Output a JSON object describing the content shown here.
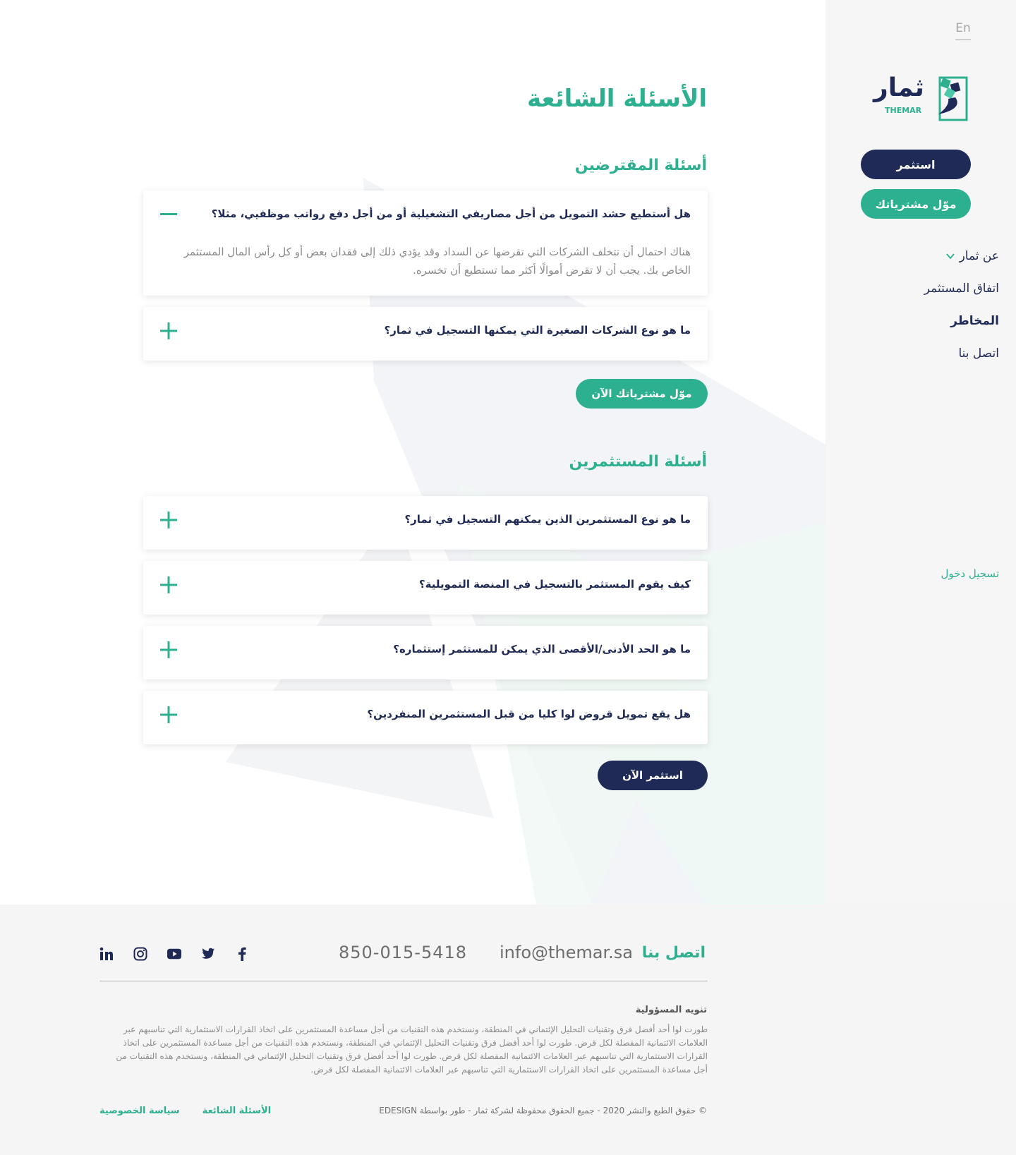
{
  "colors": {
    "navy": "#1f2a56",
    "green": "#2db08f",
    "sidebar_bg": "#f6f6f6",
    "footer_bg": "#f5f5f5"
  },
  "sidebar": {
    "lang_label": "En",
    "logo_text_ar": "ثمار",
    "logo_text_en": "THEMAR",
    "invest_button": "استثمر",
    "finance_button": "موّل مشترياتك",
    "nav": [
      {
        "label": "عن ثمار",
        "has_dropdown": true
      },
      {
        "label": "اتفاق المستثمر"
      },
      {
        "label": "المخاطر",
        "active": true
      },
      {
        "label": "اتصل بنا"
      }
    ],
    "login_link": "تسجيل دخول"
  },
  "main": {
    "title": "الأسئلة الشائعة",
    "borrowers": {
      "title": "أسئلة المقترضين",
      "items": [
        {
          "question": "هل أستطيع حشد التمويل من أجل مصاريفي التشغيلية أو من أجل دفع رواتب موظفيي، مثلا؟",
          "answer": "هناك احتمال أن تتخلف الشركات التي تقرضها عن السداد وقد يؤدي ذلك إلى فقدان بعض أو كل رأس المال المستثمر الخاص بك. يجب أن لا تقرض أموالًا أكثر مما تستطيع أن تخسره.",
          "expanded": true
        },
        {
          "question": "ما هو نوع الشركات الصغيرة التي يمكنها التسجيل في ثمار؟",
          "expanded": false
        }
      ],
      "cta": "موّل مشترياتك الآن"
    },
    "investors": {
      "title": "أسئلة المستثمرين",
      "items": [
        {
          "question": "ما هو نوع المستثمرين الذين يمكنهم التسجيل في ثمار؟",
          "expanded": false
        },
        {
          "question": "كيف يقوم المستثمر بالتسجيل في المنصة التمويلية؟",
          "expanded": false
        },
        {
          "question": "ما هو الحد الأدنى/الأقصى الذي يمكن للمستثمر إستثماره؟",
          "expanded": false
        },
        {
          "question": "هل يقع تمويل قروض لوا كليا من قبل المستثمرين المنفردين؟",
          "expanded": false
        }
      ],
      "cta": "استثمر الآن"
    }
  },
  "footer": {
    "contact_label": "اتصل بنا",
    "email": "info@themar.sa",
    "phone": "850-015-5418",
    "socials": [
      "facebook-icon",
      "twitter-icon",
      "youtube-icon",
      "instagram-icon",
      "linkedin-icon"
    ],
    "disclaimer_title": "تنويه المسؤولية",
    "disclaimer_text": "طورت لوا أحد أفضل فرق وتقنيات التحليل الإئتماني في المنطقة، ونستخدم هذه التقنيات من أجل مساعدة المستثمرين على اتخاذ القرارات الاستثمارية التي تناسبهم عبر العلامات الائتمانية المفصلة لكل قرض. طورت لوا أحد أفضل فرق وتقنيات التحليل الإئتماني في المنطقة، ونستخدم هذه التقنيات من أجل مساعدة المستثمرين على اتخاذ القرارات الاستثمارية التي تناسبهم عبر العلامات الائتمانية المفصلة لكل قرض. طورت لوا أحد أفضل فرق وتقنيات التحليل الإئتماني في المنطقة، ونستخدم هذه التقنيات من أجل مساعدة المستثمرين على اتخاذ القرارات الاستثمارية التي تناسبهم عبر العلامات الائتمانية المفصلة لكل قرض.",
    "copyright": "© حقوق الطبع والنشر 2020 - جميع الحقوق محفوظة لشركة ثمار - طور بواسطة EDESIGN",
    "links": [
      "سياسة الخصوصية",
      "الأسئلة الشائعة"
    ]
  }
}
